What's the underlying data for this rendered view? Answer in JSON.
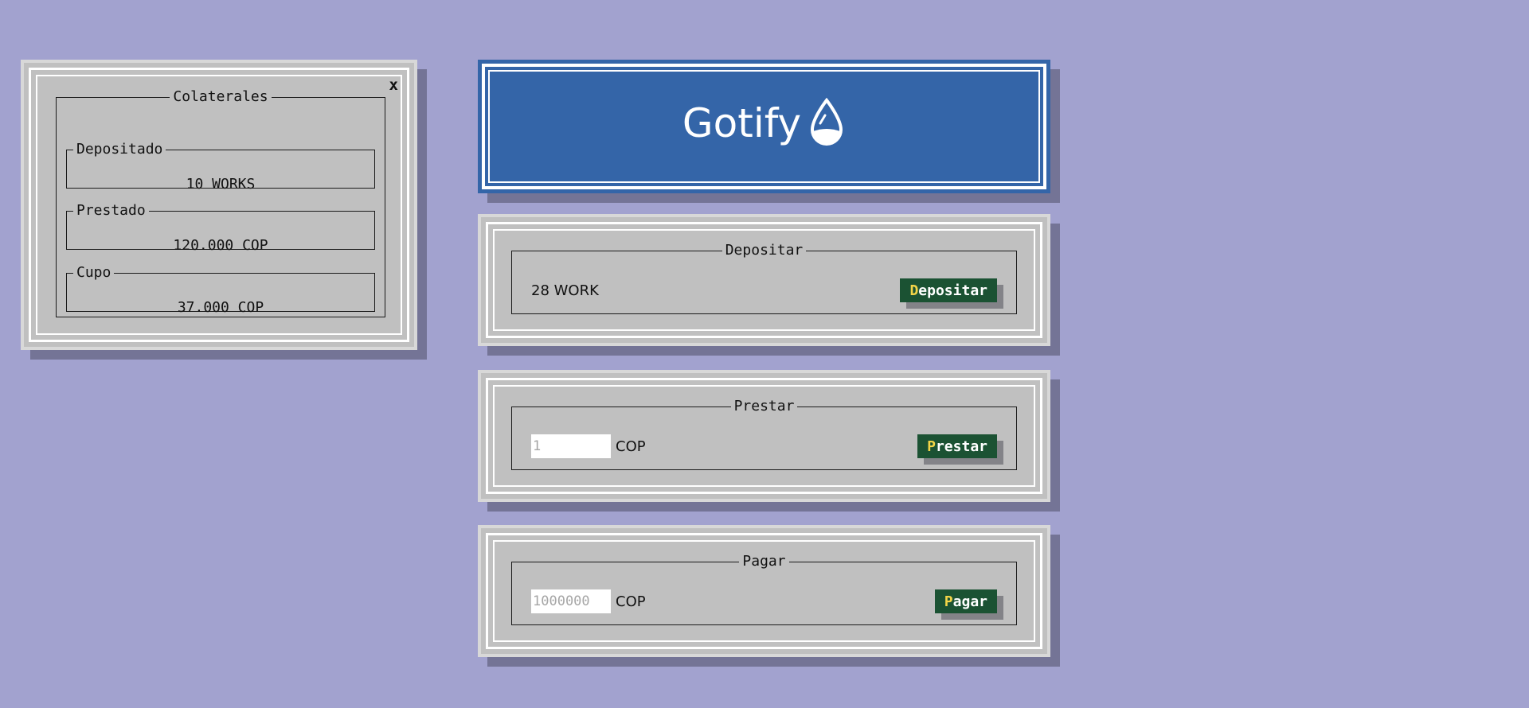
{
  "collateral": {
    "title": "Colaterales",
    "close_label": "x",
    "deposited": {
      "label": "Depositado",
      "value": "10 WORKS"
    },
    "borrowed": {
      "label": "Prestado",
      "value": "120.000 COP"
    },
    "quota": {
      "label": "Cupo",
      "value": "37.000 COP"
    }
  },
  "header": {
    "logo_text": "Gotify",
    "logo_icon": "water-drop-icon",
    "color": "#3465a8"
  },
  "deposit": {
    "title": "Depositar",
    "amount": "28 WORK",
    "button_hotkey": "D",
    "button_rest": "epositar"
  },
  "borrow": {
    "title": "Prestar",
    "placeholder": "1",
    "unit": "COP",
    "button_hotkey": "P",
    "button_rest": "restar"
  },
  "pay": {
    "title": "Pagar",
    "placeholder": "1000000",
    "unit": "COP",
    "button_hotkey": "P",
    "button_rest": "agar"
  },
  "colors": {
    "background": "#a2a2cf",
    "panel": "#c0c0c0",
    "button": "#1b5233",
    "hotkey": "#f3d548"
  }
}
